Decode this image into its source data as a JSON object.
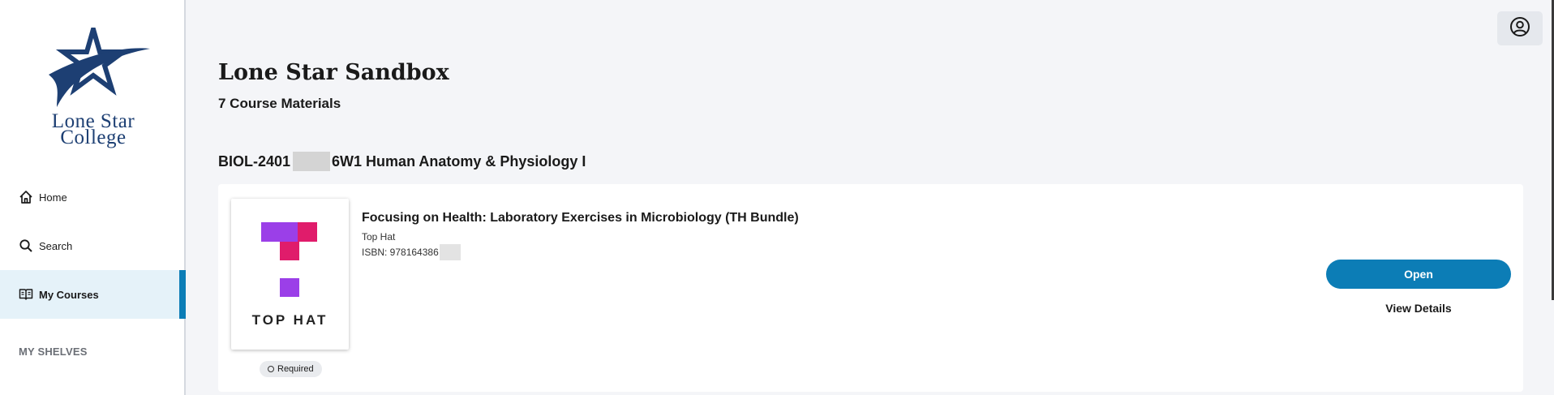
{
  "sidebar": {
    "logo": {
      "line1": "Lone Star",
      "line2": "College"
    },
    "items": [
      {
        "label": "Home",
        "icon": "home-icon"
      },
      {
        "label": "Search",
        "icon": "search-icon"
      },
      {
        "label": "My Courses",
        "icon": "book-open-icon",
        "active": true
      }
    ],
    "shelves_heading": "MY SHELVES"
  },
  "header": {
    "profile_icon": "user-circle-icon"
  },
  "main": {
    "title": "Lone Star Sandbox",
    "materials_count": "7 Course Materials",
    "course": {
      "code": "BIOL-2401",
      "section_suffix": "6W1 Human Anatomy & Physiology I"
    },
    "material": {
      "title": "Focusing on Health: Laboratory Exercises in Microbiology (TH Bundle)",
      "publisher": "Top Hat",
      "isbn": "ISBN: 978164386",
      "cover_text": "TOP HAT",
      "badge": "Required",
      "open_label": "Open",
      "details_label": "View Details"
    }
  },
  "colors": {
    "accent": "#0c7db6",
    "logo_navy": "#1d3f73",
    "tophat_purple": "#9b3fe8",
    "tophat_pink": "#e01c6b"
  }
}
